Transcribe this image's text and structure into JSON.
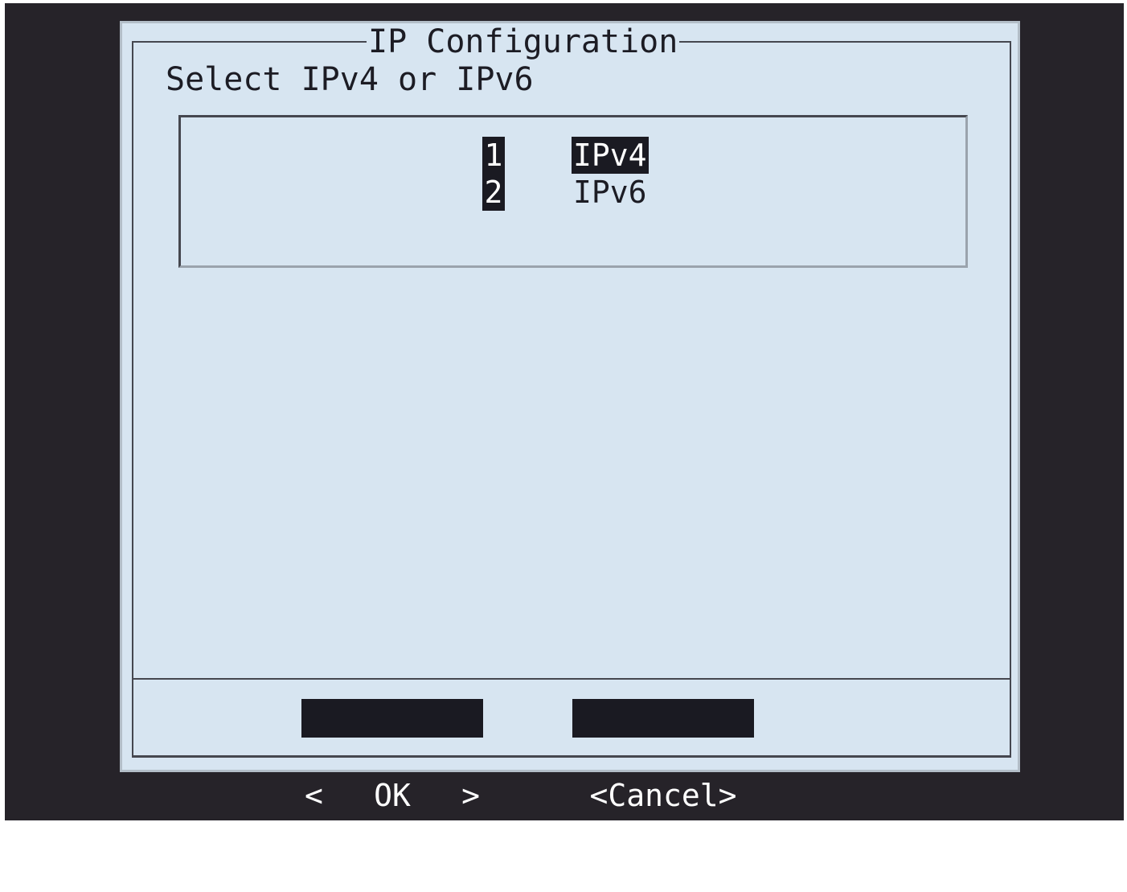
{
  "dialog": {
    "title": "IP Configuration",
    "prompt": "Select IPv4 or IPv6",
    "items": [
      {
        "tag": "1",
        "label": "IPv4",
        "selected": true
      },
      {
        "tag": "2",
        "label": "IPv6",
        "selected": false
      }
    ],
    "buttons": {
      "ok": {
        "left": "<",
        "label": "OK",
        "right": ">"
      },
      "cancel": {
        "label": "<Cancel>"
      }
    }
  },
  "colors": {
    "screen_background": "#262329",
    "dialog_background": "#d7e5f1",
    "highlight": "#1a1a22",
    "border": "#45474f"
  }
}
